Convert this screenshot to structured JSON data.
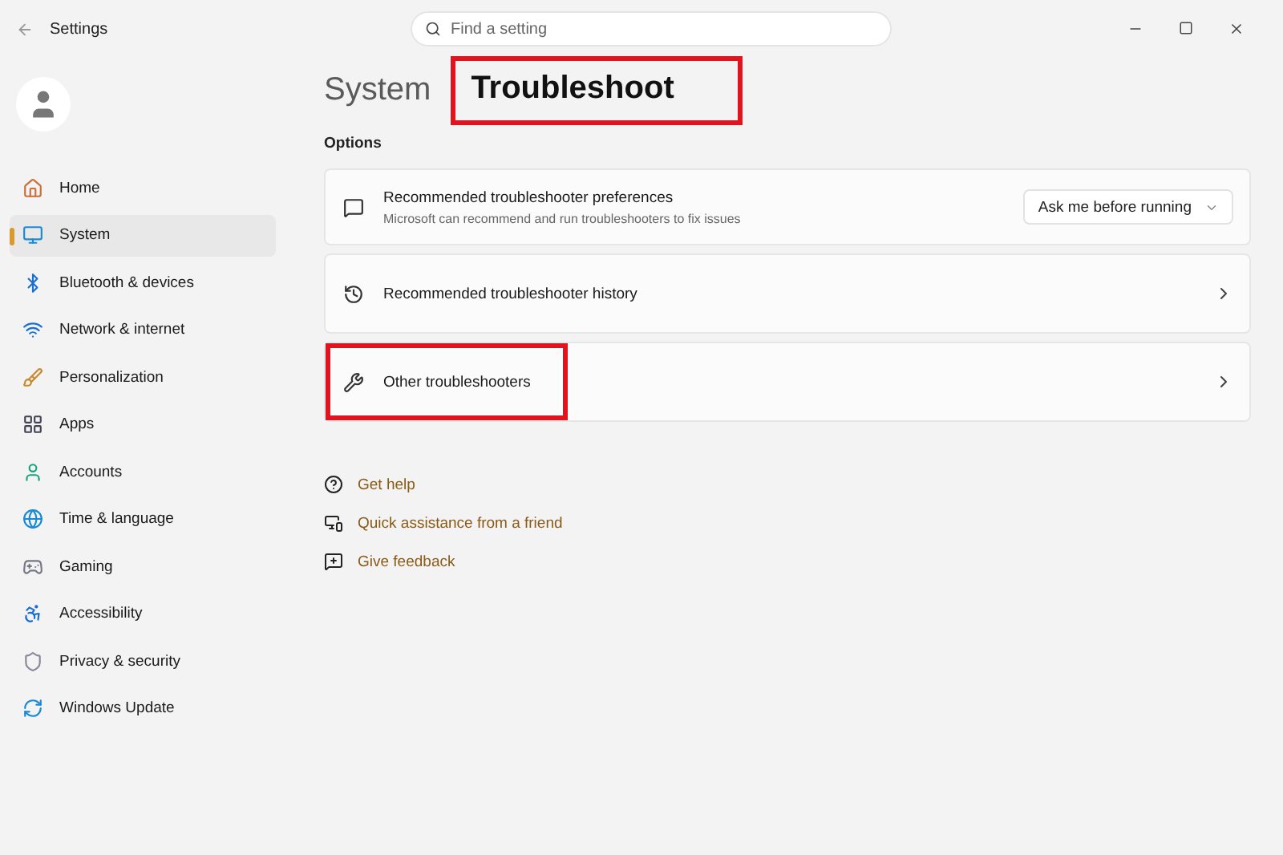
{
  "window": {
    "title": "Settings"
  },
  "search": {
    "placeholder": "Find a setting"
  },
  "sidebar": {
    "items": [
      {
        "label": "Home",
        "selected": false
      },
      {
        "label": "System",
        "selected": true
      },
      {
        "label": "Bluetooth & devices",
        "selected": false
      },
      {
        "label": "Network & internet",
        "selected": false
      },
      {
        "label": "Personalization",
        "selected": false
      },
      {
        "label": "Apps",
        "selected": false
      },
      {
        "label": "Accounts",
        "selected": false
      },
      {
        "label": "Time & language",
        "selected": false
      },
      {
        "label": "Gaming",
        "selected": false
      },
      {
        "label": "Accessibility",
        "selected": false
      },
      {
        "label": "Privacy & security",
        "selected": false
      },
      {
        "label": "Windows Update",
        "selected": false
      }
    ]
  },
  "breadcrumb": {
    "parent": "System",
    "current": "Troubleshoot",
    "highlighted": true
  },
  "section": "Options",
  "options": [
    {
      "kind": "dropdown",
      "title": "Recommended troubleshooter preferences",
      "subtitle": "Microsoft can recommend and run troubleshooters to fix issues",
      "value": "Ask me before running",
      "highlighted": false
    },
    {
      "kind": "link",
      "title": "Recommended troubleshooter history",
      "highlighted": false
    },
    {
      "kind": "link",
      "title": "Other troubleshooters",
      "highlighted": true
    }
  ],
  "links": [
    "Get help",
    "Quick assistance from a friend",
    "Give feedback"
  ]
}
